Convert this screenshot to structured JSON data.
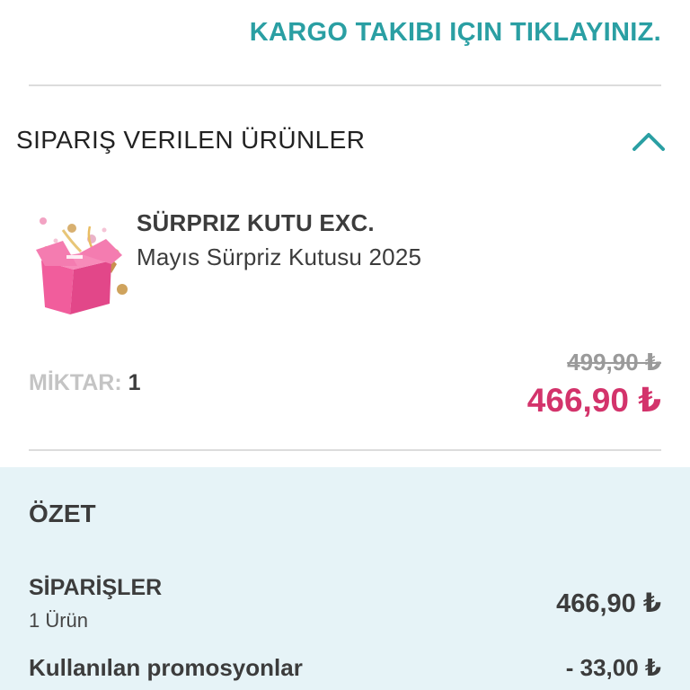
{
  "tracking": {
    "label": "KARGO TAKIBI IÇIN TIKLAYINIZ."
  },
  "ordered_items": {
    "section_title": "SIPARIŞ VERILEN ÜRÜNLER",
    "toggle_icon": "chevron-up-icon",
    "item": {
      "image_icon": "pink-gift-box-image",
      "brand": "SÜRPRIZ KUTU EXC.",
      "name": "Mayıs Sürpriz Kutusu 2025",
      "quantity_label": "MİKTAR:",
      "quantity": "1",
      "original_price": "499,90 ₺",
      "price": "466,90 ₺"
    }
  },
  "summary": {
    "title": "ÖZET",
    "orders_label": "SİPARİŞLER",
    "orders_count": "1 Ürün",
    "orders_total": "466,90 ₺",
    "promotions_label": "Kullanılan promosyonlar",
    "promotions_value": "- 33,00 ₺"
  },
  "colors": {
    "accent": "#2a9fa3",
    "price": "#d3336b",
    "summary_background": "#e6f3f7",
    "divider": "#dcdcdc"
  }
}
